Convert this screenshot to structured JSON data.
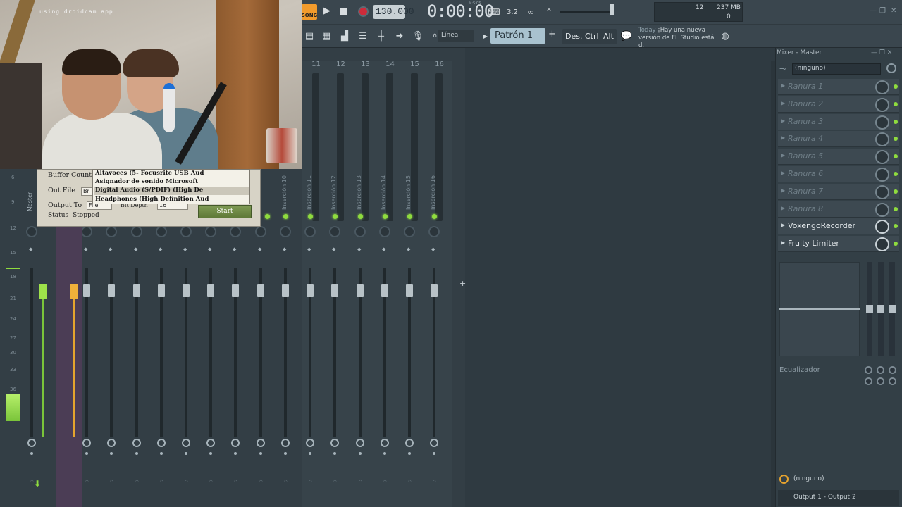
{
  "webcam": {
    "caption": "using droidcam app"
  },
  "transport": {
    "song_badge": "SONG",
    "bpm": "130.000",
    "time": "0:00:00",
    "time_unit": "M:S:CS",
    "cpu": "12",
    "memory": "237 MB",
    "poly": "0"
  },
  "toolbar2": {
    "snap": "Línea",
    "pattern": "Patrón 1",
    "des_label": "Des.",
    "ctrl_label": "Ctrl",
    "alt_label": "Alt",
    "news_prefix": "Today",
    "news_text": "¡Hay una nueva versión de FL Studio está d.."
  },
  "dialog": {
    "buffer_label": "Buffer Count",
    "outfile_label": "Out File",
    "outfile_value": "Br",
    "outputto_label": "Output To",
    "outputto_value": "File",
    "bitdepth_label": "Bit Depth",
    "bitdepth_value": "16",
    "status_label": "Status",
    "status_value": "Stopped",
    "start_label": "Start",
    "dropdown_items": [
      "Altavoces (5- Focusrite USB Aud",
      "Asignador de sonido Microsoft",
      "Digital Audio (S/PDIF) (High De",
      "Headphones (High Definition Aud"
    ],
    "selected_index": 2
  },
  "mixer": {
    "master_label": "Master",
    "channel_numbers": [
      "11",
      "12",
      "13",
      "14",
      "15",
      "16"
    ],
    "insert_labels": [
      "Inserción 10",
      "Inserción 11",
      "Inserción 12",
      "Inserción 13",
      "Inserción 14",
      "Inserción 15",
      "Inserción 16"
    ],
    "db_scale": [
      "6",
      "9",
      "12",
      "15",
      "18",
      "21",
      "24",
      "27",
      "30",
      "33",
      "36"
    ]
  },
  "master_panel": {
    "title": "Mixer - Master",
    "input": "(ninguno)",
    "slots": [
      {
        "name": "Ranura 1",
        "active": false
      },
      {
        "name": "Ranura 2",
        "active": false
      },
      {
        "name": "Ranura 3",
        "active": false
      },
      {
        "name": "Ranura 4",
        "active": false
      },
      {
        "name": "Ranura 5",
        "active": false
      },
      {
        "name": "Ranura 6",
        "active": false
      },
      {
        "name": "Ranura 7",
        "active": false
      },
      {
        "name": "Ranura 8",
        "active": false
      },
      {
        "name": "VoxengoRecorder",
        "active": true
      },
      {
        "name": "Fruity Limiter",
        "active": true
      }
    ],
    "eq_label": "Ecualizador",
    "bottom_input": "(ninguno)",
    "output": "Output 1 - Output 2"
  },
  "colors": {
    "accent_green": "#8fdc3e",
    "record_red": "#ce2b3a",
    "song_orange": "#f29b2c"
  }
}
